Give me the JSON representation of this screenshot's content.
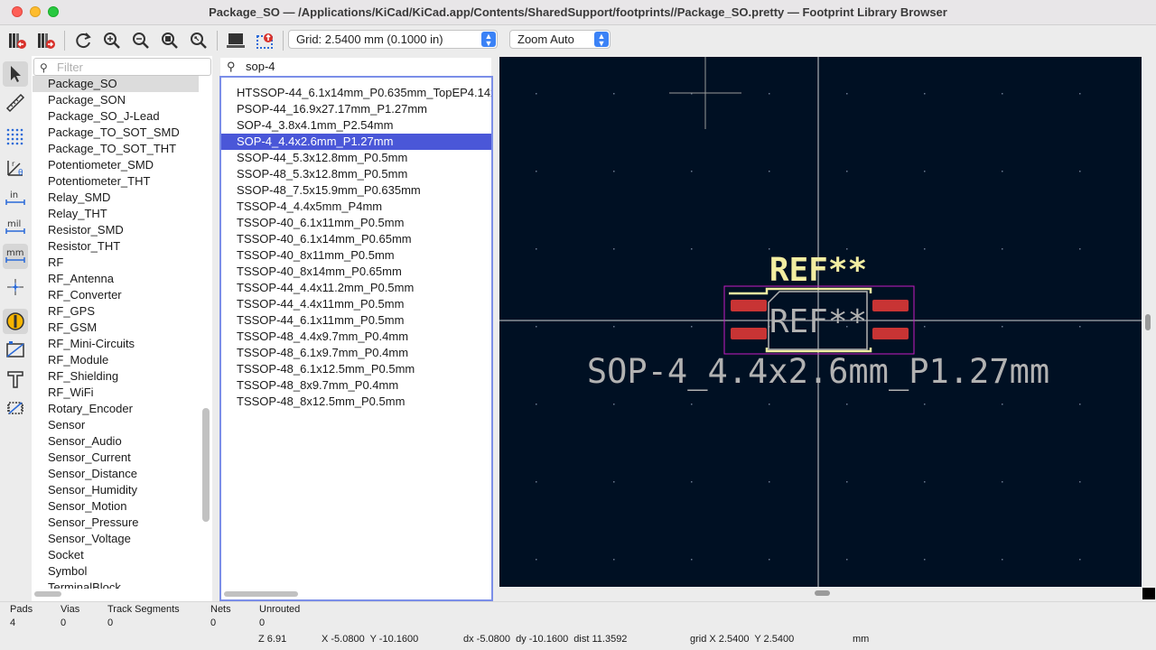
{
  "window": {
    "title": "Package_SO — /Applications/KiCad/KiCad.app/Contents/SharedSupport/footprints//Package_SO.pretty — Footprint Library Browser"
  },
  "toolbar": {
    "grid_select": "Grid: 2.5400 mm (0.1000 in)",
    "zoom_select": "Zoom Auto"
  },
  "library_filter": {
    "placeholder": "Filter"
  },
  "libraries": [
    {
      "label": "Package_SO",
      "selected": true
    },
    {
      "label": "Package_SON"
    },
    {
      "label": "Package_SO_J-Lead"
    },
    {
      "label": "Package_TO_SOT_SMD"
    },
    {
      "label": "Package_TO_SOT_THT"
    },
    {
      "label": "Potentiometer_SMD"
    },
    {
      "label": "Potentiometer_THT"
    },
    {
      "label": "Relay_SMD"
    },
    {
      "label": "Relay_THT"
    },
    {
      "label": "Resistor_SMD"
    },
    {
      "label": "Resistor_THT"
    },
    {
      "label": "RF"
    },
    {
      "label": "RF_Antenna"
    },
    {
      "label": "RF_Converter"
    },
    {
      "label": "RF_GPS"
    },
    {
      "label": "RF_GSM"
    },
    {
      "label": "RF_Mini-Circuits"
    },
    {
      "label": "RF_Module"
    },
    {
      "label": "RF_Shielding"
    },
    {
      "label": "RF_WiFi"
    },
    {
      "label": "Rotary_Encoder"
    },
    {
      "label": "Sensor"
    },
    {
      "label": "Sensor_Audio"
    },
    {
      "label": "Sensor_Current"
    },
    {
      "label": "Sensor_Distance"
    },
    {
      "label": "Sensor_Humidity"
    },
    {
      "label": "Sensor_Motion"
    },
    {
      "label": "Sensor_Pressure"
    },
    {
      "label": "Sensor_Voltage"
    },
    {
      "label": "Socket"
    },
    {
      "label": "Symbol"
    },
    {
      "label": "TerminalBlock"
    }
  ],
  "footprint_search": {
    "value": "sop-4"
  },
  "footprints": [
    {
      "label": "HTSSOP-44_6.1x14mm_P0.635mm_TopEP4.14x7.36mm"
    },
    {
      "label": "PSOP-44_16.9x27.17mm_P1.27mm"
    },
    {
      "label": "SOP-4_3.8x4.1mm_P2.54mm"
    },
    {
      "label": "SOP-4_4.4x2.6mm_P1.27mm",
      "selected": true
    },
    {
      "label": "SSOP-44_5.3x12.8mm_P0.5mm"
    },
    {
      "label": "SSOP-48_5.3x12.8mm_P0.5mm"
    },
    {
      "label": "SSOP-48_7.5x15.9mm_P0.635mm"
    },
    {
      "label": "TSSOP-4_4.4x5mm_P4mm"
    },
    {
      "label": "TSSOP-40_6.1x11mm_P0.5mm"
    },
    {
      "label": "TSSOP-40_6.1x14mm_P0.65mm"
    },
    {
      "label": "TSSOP-40_8x11mm_P0.5mm"
    },
    {
      "label": "TSSOP-40_8x14mm_P0.65mm"
    },
    {
      "label": "TSSOP-44_4.4x11.2mm_P0.5mm"
    },
    {
      "label": "TSSOP-44_4.4x11mm_P0.5mm"
    },
    {
      "label": "TSSOP-44_6.1x11mm_P0.5mm"
    },
    {
      "label": "TSSOP-48_4.4x9.7mm_P0.4mm"
    },
    {
      "label": "TSSOP-48_6.1x9.7mm_P0.4mm"
    },
    {
      "label": "TSSOP-48_6.1x12.5mm_P0.5mm"
    },
    {
      "label": "TSSOP-48_8x9.7mm_P0.4mm"
    },
    {
      "label": "TSSOP-48_8x12.5mm_P0.5mm"
    }
  ],
  "canvas": {
    "ref_top": "REF**",
    "ref_center": "REF**",
    "footprint_value": "SOP-4_4.4x2.6mm_P1.27mm",
    "colors": {
      "background": "#001023",
      "silkscreen": "#f2eda1",
      "fab_text": "#b2b2b2",
      "pad": "#c83434",
      "courtyard": "#c61bc6",
      "crosshair": "#d0d0d0"
    }
  },
  "stats": {
    "pads_label": "Pads",
    "pads_value": "4",
    "vias_label": "Vias",
    "vias_value": "0",
    "tracks_label": "Track Segments",
    "tracks_value": "0",
    "nets_label": "Nets",
    "nets_value": "0",
    "unrouted_label": "Unrouted",
    "unrouted_value": "0"
  },
  "statusbar": {
    "zoom": "Z 6.91",
    "cursor": "X -5.0800  Y -10.1600",
    "delta": "dx -5.0800  dy -10.1600  dist 11.3592",
    "grid": "grid X 2.5400  Y 2.5400",
    "units": "mm"
  }
}
